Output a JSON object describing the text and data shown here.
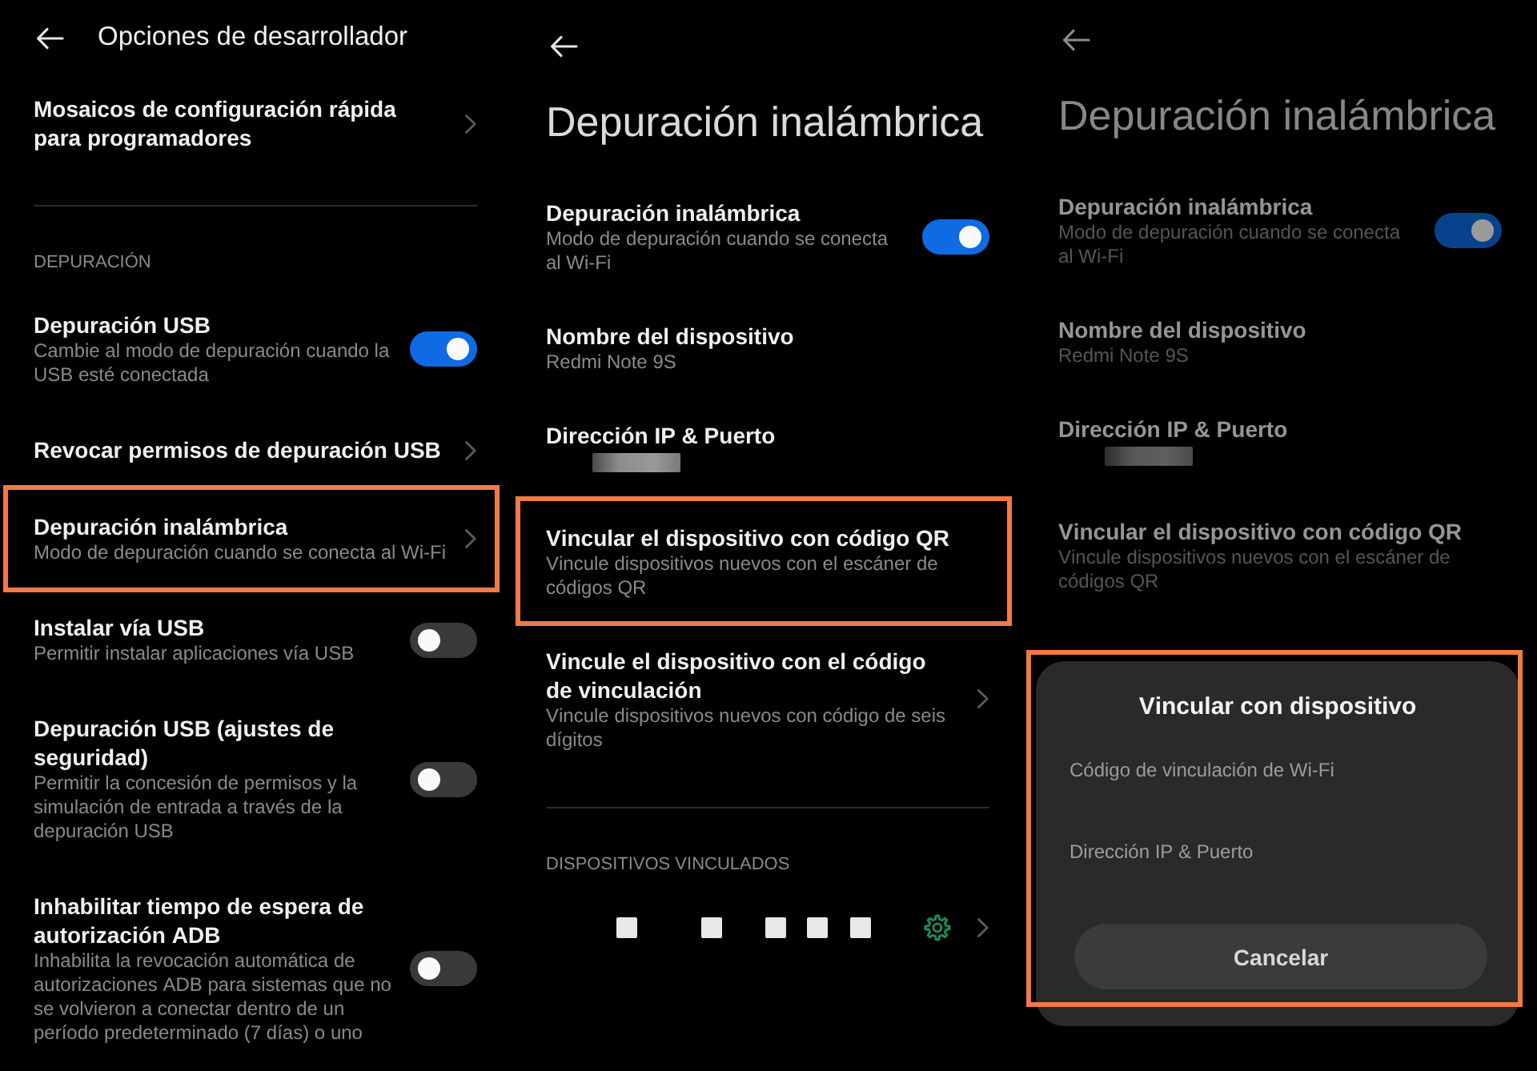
{
  "panels": [
    {
      "header": {
        "kind": "inline",
        "title": "Opciones de desarrollador"
      },
      "items": [
        {
          "kind": "nav",
          "title": "Mosaicos de configuración rápida para programadores",
          "highlighted": false
        },
        {
          "kind": "divider"
        },
        {
          "kind": "section",
          "label": "DEPURACIÓN"
        },
        {
          "kind": "toggle",
          "title": "Depuración USB",
          "subtitle": "Cambie al modo de depuración cuando la USB esté conectada",
          "on": true,
          "highlighted": false
        },
        {
          "kind": "nav",
          "title": "Revocar permisos de depuración USB",
          "highlighted": false
        },
        {
          "kind": "nav",
          "title": "Depuración inalámbrica",
          "subtitle": "Modo de depuración cuando se conecta al Wi-Fi",
          "highlighted": true
        },
        {
          "kind": "toggle",
          "title": "Instalar vía USB",
          "subtitle": "Permitir instalar aplicaciones vía USB",
          "on": false,
          "highlighted": false
        },
        {
          "kind": "toggle",
          "title": "Depuración USB (ajustes de seguridad)",
          "subtitle": "Permitir la concesión de permisos y la simulación de entrada a través de la depuración USB",
          "on": false,
          "highlighted": false
        },
        {
          "kind": "toggle",
          "title": "Inhabilitar tiempo de espera de autorización ADB",
          "subtitle": "Inhabilita la revocación automática de autorizaciones ADB para sistemas que no se volvieron a conectar dentro de un período predeterminado (7 días) o uno",
          "on": false,
          "highlighted": false
        }
      ]
    },
    {
      "header": {
        "kind": "large",
        "title": "Depuración inalámbrica"
      },
      "items": [
        {
          "kind": "toggle",
          "title": "Depuración inalámbrica",
          "subtitle": "Modo de depuración cuando se conecta al Wi-Fi",
          "on": true,
          "highlighted": false
        },
        {
          "kind": "info",
          "title": "Nombre del dispositivo",
          "subtitle": "Redmi Note 9S",
          "highlighted": false
        },
        {
          "kind": "redacted",
          "title": "Dirección IP & Puerto",
          "highlighted": false
        },
        {
          "kind": "plain",
          "title": "Vincular el dispositivo con código QR",
          "subtitle": "Vincule dispositivos nuevos con el escáner de códigos QR",
          "highlighted": true
        },
        {
          "kind": "nav",
          "title": "Vincule el dispositivo con el código de vinculación",
          "subtitle": "Vincule dispositivos nuevos con código de seis dígitos",
          "highlighted": false
        },
        {
          "kind": "divider"
        },
        {
          "kind": "section",
          "label": "DISPOSITIVOS VINCULADOS"
        },
        {
          "kind": "device"
        }
      ]
    },
    {
      "header": {
        "kind": "large",
        "title": "Depuración inalámbrica"
      },
      "items": [
        {
          "kind": "toggle",
          "title": "Depuración inalámbrica",
          "subtitle": "Modo de depuración cuando se conecta al Wi-Fi",
          "on": true,
          "highlighted": false
        },
        {
          "kind": "info",
          "title": "Nombre del dispositivo",
          "subtitle": "Redmi Note 9S",
          "highlighted": false
        },
        {
          "kind": "redacted",
          "title": "Dirección IP & Puerto",
          "highlighted": false
        },
        {
          "kind": "plain",
          "title": "Vincular el dispositivo con código QR",
          "subtitle": "Vincule dispositivos nuevos con el escáner de códigos QR",
          "highlighted": false
        }
      ],
      "dialog": {
        "title": "Vincular con dispositivo",
        "lines": [
          "Código de vinculación de Wi-Fi",
          "Dirección IP & Puerto"
        ],
        "button": "Cancelar",
        "highlighted": true
      }
    }
  ]
}
